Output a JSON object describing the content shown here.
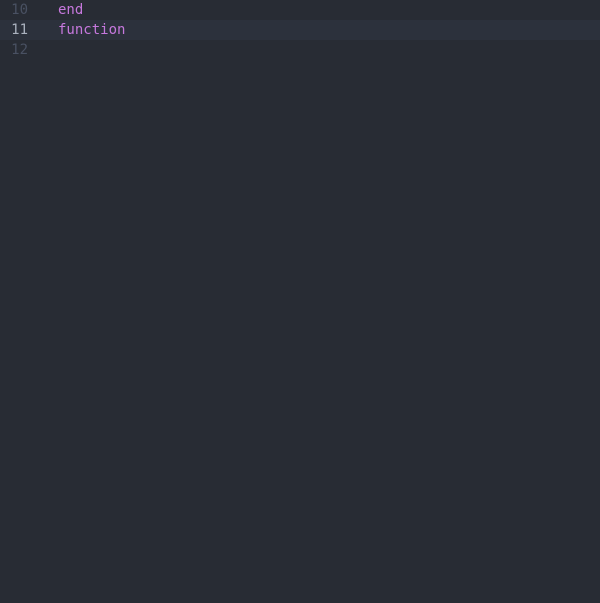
{
  "editor": {
    "lines": [
      {
        "num": "10",
        "current": false,
        "tokenClass": "kw-end",
        "text": "end"
      },
      {
        "num": "11",
        "current": true,
        "tokenClass": "kw-func",
        "text": "function"
      },
      {
        "num": "12",
        "current": false,
        "tokenClass": "",
        "text": ""
      }
    ]
  }
}
